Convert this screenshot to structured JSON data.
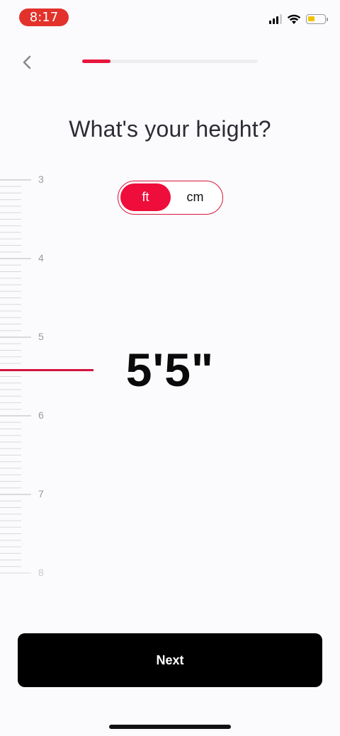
{
  "status_bar": {
    "time": "8:17",
    "time_pill_color": "#e2322b",
    "icons": [
      "cellular-signal-icon",
      "wifi-icon",
      "battery-icon"
    ]
  },
  "header": {
    "back_icon": "chevron-left-icon",
    "progress_fraction": 0.16,
    "accent_color": "#e7153c"
  },
  "title": "What's your height?",
  "unit_toggle": {
    "options": [
      "ft",
      "cm"
    ],
    "selected": "ft"
  },
  "ruler": {
    "labels": [
      "3",
      "4",
      "5",
      "6",
      "7",
      "8"
    ],
    "minor_ticks_per_unit": 12
  },
  "height_value": "5'5\"",
  "next_button": {
    "label": "Next"
  }
}
